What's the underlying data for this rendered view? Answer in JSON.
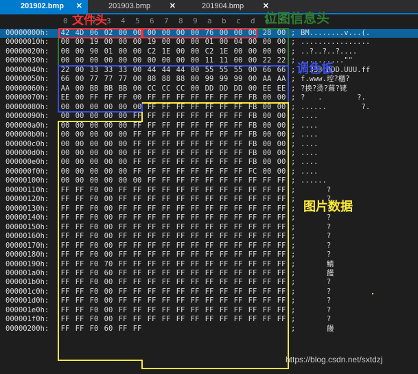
{
  "tabs": [
    {
      "label": "201902.bmp",
      "active": true,
      "close": "✕"
    },
    {
      "label": "201903.bmp",
      "active": false,
      "close": "✕"
    },
    {
      "label": "201904.bmp",
      "active": false,
      "close": "✕"
    }
  ],
  "column_header": [
    "0",
    "1",
    "2",
    "3",
    "4",
    "5",
    "6",
    "7",
    "8",
    "9",
    "a",
    "b",
    "c",
    "d",
    "e",
    "f"
  ],
  "annotations": {
    "file_header": "文件头",
    "info_header": "位图信息头",
    "palette": "调色板",
    "pixel_data": "图片数据"
  },
  "watermark": "https://blog.csdn.net/sxtdzj",
  "colors": {
    "file_header": "#ff3030",
    "info_header": "#2e7d32",
    "palette": "#3a4fe0",
    "pixel_data": "#ffeb3b",
    "selection": "#0e639c",
    "tab_active": "#007acc"
  },
  "rows": [
    {
      "addr": "00000000h:",
      "bytes": [
        "42",
        "4D",
        "06",
        "02",
        "00",
        "00",
        "00",
        "00",
        "00",
        "00",
        "76",
        "00",
        "00",
        "00",
        "28",
        "00"
      ],
      "ascii": "BM........v...(.",
      "selected": true
    },
    {
      "addr": "00000010h:",
      "bytes": [
        "00",
        "00",
        "19",
        "00",
        "00",
        "00",
        "19",
        "00",
        "00",
        "00",
        "01",
        "00",
        "04",
        "00",
        "00",
        "00"
      ],
      "ascii": "................"
    },
    {
      "addr": "00000020h:",
      "bytes": [
        "00",
        "00",
        "90",
        "01",
        "00",
        "00",
        "C2",
        "1E",
        "00",
        "00",
        "C2",
        "1E",
        "00",
        "00",
        "00",
        "00"
      ],
      "ascii": "..?..?..?...."
    },
    {
      "addr": "00000030h:",
      "bytes": [
        "00",
        "00",
        "00",
        "00",
        "00",
        "00",
        "00",
        "00",
        "00",
        "00",
        "11",
        "11",
        "00",
        "00",
        "22",
        "22"
      ],
      "ascii": "..........\"\""
    },
    {
      "addr": "00000040h:",
      "bytes": [
        "22",
        "00",
        "33",
        "33",
        "33",
        "00",
        "44",
        "44",
        "44",
        "00",
        "55",
        "55",
        "55",
        "00",
        "66",
        "66"
      ],
      "ascii": "\".333.DDD.UUU.ff"
    },
    {
      "addr": "00000050h:",
      "bytes": [
        "66",
        "00",
        "77",
        "77",
        "77",
        "00",
        "88",
        "88",
        "88",
        "00",
        "99",
        "99",
        "99",
        "00",
        "AA",
        "AA"
      ],
      "ascii": "f.www.埪?櫃?"
    },
    {
      "addr": "00000060h:",
      "bytes": [
        "AA",
        "00",
        "BB",
        "BB",
        "BB",
        "00",
        "CC",
        "CC",
        "CC",
        "00",
        "DD",
        "DD",
        "DD",
        "00",
        "EE",
        "EE"
      ],
      "ascii": "?换?烫?葺?铑"
    },
    {
      "addr": "00000070h:",
      "bytes": [
        "EE",
        "00",
        "FF",
        "FF",
        "FF",
        "00",
        "FF",
        "FF",
        "FF",
        "FF",
        "FF",
        "FF",
        "FF",
        "FB",
        "00",
        "00"
      ],
      "ascii": "?   .        ?."
    },
    {
      "addr": "00000080h:",
      "bytes": [
        "00",
        "00",
        "00",
        "00",
        "00",
        "00",
        "FF",
        "FF",
        "FF",
        "FF",
        "FF",
        "FF",
        "FF",
        "FB",
        "00",
        "00"
      ],
      "ascii": "......        ?."
    },
    {
      "addr": "00000090h:",
      "bytes": [
        "00",
        "00",
        "00",
        "00",
        "00",
        "FF",
        "FF",
        "FF",
        "FF",
        "FF",
        "FF",
        "FF",
        "FF",
        "FB",
        "00",
        "00"
      ],
      "ascii": "...."
    },
    {
      "addr": "000000a0h:",
      "bytes": [
        "00",
        "00",
        "00",
        "00",
        "00",
        "FF",
        "FF",
        "FF",
        "FF",
        "FF",
        "FF",
        "FF",
        "FF",
        "FB",
        "00",
        "00"
      ],
      "ascii": "...."
    },
    {
      "addr": "000000b0h:",
      "bytes": [
        "00",
        "00",
        "00",
        "00",
        "00",
        "FF",
        "FF",
        "FF",
        "FF",
        "FF",
        "FF",
        "FF",
        "FF",
        "FB",
        "00",
        "00"
      ],
      "ascii": "...."
    },
    {
      "addr": "000000c0h:",
      "bytes": [
        "00",
        "00",
        "00",
        "00",
        "00",
        "FF",
        "FF",
        "FF",
        "FF",
        "FF",
        "FF",
        "FF",
        "FF",
        "FB",
        "00",
        "00"
      ],
      "ascii": "...."
    },
    {
      "addr": "000000d0h:",
      "bytes": [
        "00",
        "00",
        "00",
        "00",
        "00",
        "FF",
        "FF",
        "FF",
        "FF",
        "FF",
        "FF",
        "FF",
        "FF",
        "FB",
        "00",
        "00"
      ],
      "ascii": "...."
    },
    {
      "addr": "000000e0h:",
      "bytes": [
        "00",
        "00",
        "00",
        "00",
        "00",
        "FF",
        "FF",
        "FF",
        "FF",
        "FF",
        "FF",
        "FF",
        "FF",
        "FB",
        "00",
        "00"
      ],
      "ascii": "...."
    },
    {
      "addr": "000000f0h:",
      "bytes": [
        "00",
        "00",
        "00",
        "00",
        "00",
        "FF",
        "FF",
        "FF",
        "FF",
        "FF",
        "FF",
        "FF",
        "FF",
        "FC",
        "00",
        "00"
      ],
      "ascii": "...."
    },
    {
      "addr": "00000100h:",
      "bytes": [
        "00",
        "00",
        "00",
        "00",
        "00",
        "00",
        "FF",
        "FF",
        "FF",
        "FF",
        "FF",
        "FF",
        "FF",
        "FF",
        "FF",
        "FF"
      ],
      "ascii": "......"
    },
    {
      "addr": "00000110h:",
      "bytes": [
        "FF",
        "FF",
        "F0",
        "00",
        "FF",
        "FF",
        "FF",
        "FF",
        "FF",
        "FF",
        "FF",
        "FF",
        "FF",
        "FF",
        "FF",
        "FF"
      ],
      "ascii": "      ?"
    },
    {
      "addr": "00000120h:",
      "bytes": [
        "FF",
        "FF",
        "F0",
        "00",
        "FF",
        "FF",
        "FF",
        "FF",
        "FF",
        "FF",
        "FF",
        "FF",
        "FF",
        "FF",
        "FF",
        "FF"
      ],
      "ascii": "      ?"
    },
    {
      "addr": "00000130h:",
      "bytes": [
        "FF",
        "FF",
        "F0",
        "00",
        "FF",
        "FF",
        "FF",
        "FF",
        "FF",
        "FF",
        "FF",
        "FF",
        "FF",
        "FF",
        "FF",
        "FF"
      ],
      "ascii": "      ?"
    },
    {
      "addr": "00000140h:",
      "bytes": [
        "FF",
        "FF",
        "F0",
        "00",
        "FF",
        "FF",
        "FF",
        "FF",
        "FF",
        "FF",
        "FF",
        "FF",
        "FF",
        "FF",
        "FF",
        "FF"
      ],
      "ascii": "      ?"
    },
    {
      "addr": "00000150h:",
      "bytes": [
        "FF",
        "FF",
        "F0",
        "00",
        "FF",
        "FF",
        "FF",
        "FF",
        "FF",
        "FF",
        "FF",
        "FF",
        "FF",
        "FF",
        "FF",
        "FF"
      ],
      "ascii": "      ?"
    },
    {
      "addr": "00000160h:",
      "bytes": [
        "FF",
        "FF",
        "F0",
        "00",
        "FF",
        "FF",
        "FF",
        "FF",
        "FF",
        "FF",
        "FF",
        "FF",
        "FF",
        "FF",
        "FF",
        "FF"
      ],
      "ascii": "      ?"
    },
    {
      "addr": "00000170h:",
      "bytes": [
        "FF",
        "FF",
        "F0",
        "00",
        "FF",
        "FF",
        "FF",
        "FF",
        "FF",
        "FF",
        "FF",
        "FF",
        "FF",
        "FF",
        "FF",
        "FF"
      ],
      "ascii": "      ?"
    },
    {
      "addr": "00000180h:",
      "bytes": [
        "FF",
        "FF",
        "F0",
        "00",
        "FF",
        "FF",
        "FF",
        "FF",
        "FF",
        "FF",
        "FF",
        "FF",
        "FF",
        "FF",
        "FF",
        "FF"
      ],
      "ascii": "      ?"
    },
    {
      "addr": "00000190h:",
      "bytes": [
        "FF",
        "FF",
        "F0",
        "70",
        "FF",
        "FF",
        "FF",
        "FF",
        "FF",
        "FF",
        "FF",
        "FF",
        "FF",
        "FF",
        "FF",
        "FF"
      ],
      "ascii": "      鯖"
    },
    {
      "addr": "000001a0h:",
      "bytes": [
        "FF",
        "FF",
        "F0",
        "60",
        "FF",
        "FF",
        "FF",
        "FF",
        "FF",
        "FF",
        "FF",
        "FF",
        "FF",
        "FF",
        "FF",
        "FF"
      ],
      "ascii": "      饅"
    },
    {
      "addr": "000001b0h:",
      "bytes": [
        "FF",
        "FF",
        "F0",
        "00",
        "FF",
        "FF",
        "FF",
        "FF",
        "FF",
        "FF",
        "FF",
        "FF",
        "FF",
        "FF",
        "FF",
        "FF"
      ],
      "ascii": "      ?"
    },
    {
      "addr": "000001c0h:",
      "bytes": [
        "FF",
        "FF",
        "F0",
        "00",
        "FF",
        "FF",
        "FF",
        "FF",
        "FF",
        "FF",
        "FF",
        "FF",
        "FF",
        "FF",
        "FF",
        "FF"
      ],
      "ascii": "      ?"
    },
    {
      "addr": "000001d0h:",
      "bytes": [
        "FF",
        "FF",
        "F0",
        "00",
        "FF",
        "FF",
        "FF",
        "FF",
        "FF",
        "FF",
        "FF",
        "FF",
        "FF",
        "FF",
        "FF",
        "FF"
      ],
      "ascii": "      ?"
    },
    {
      "addr": "000001e0h:",
      "bytes": [
        "FF",
        "FF",
        "F0",
        "00",
        "FF",
        "FF",
        "FF",
        "FF",
        "FF",
        "FF",
        "FF",
        "FF",
        "FF",
        "FF",
        "FF",
        "FF"
      ],
      "ascii": "      ?"
    },
    {
      "addr": "000001f0h:",
      "bytes": [
        "FF",
        "FF",
        "F0",
        "00",
        "FF",
        "FF",
        "FF",
        "FF",
        "FF",
        "FF",
        "FF",
        "FF",
        "FF",
        "FF",
        "FF",
        "FF"
      ],
      "ascii": "      ?"
    },
    {
      "addr": "00000200h:",
      "bytes": [
        "FF",
        "FF",
        "F0",
        "60",
        "FF",
        "FF"
      ],
      "ascii": "      饅"
    }
  ]
}
